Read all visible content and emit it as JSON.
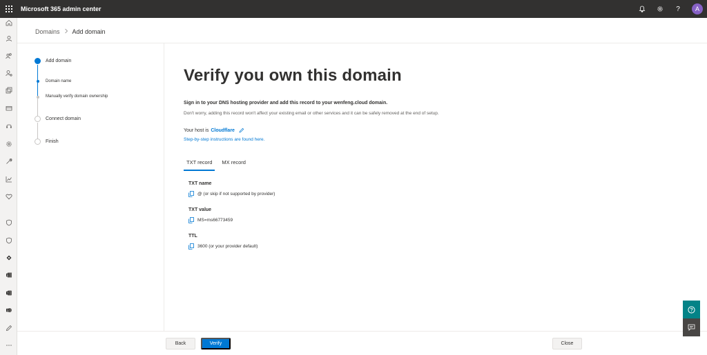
{
  "app": {
    "title": "Microsoft 365 admin center"
  },
  "topbar": {
    "avatar_initial": "A"
  },
  "breadcrumb": {
    "parent": "Domains",
    "current": "Add domain"
  },
  "stepper": {
    "steps": [
      {
        "label": "Add domain",
        "state": "current"
      },
      {
        "label": "Domain name",
        "state": "substep-done"
      },
      {
        "label": "Manually verify domain ownership",
        "state": "substep-current"
      },
      {
        "label": "Connect domain",
        "state": "pending"
      },
      {
        "label": "Finish",
        "state": "pending"
      }
    ]
  },
  "main": {
    "title": "Verify you own this domain",
    "instruction": "Sign in to your DNS hosting provider and add this record to your wenfeng.cloud domain.",
    "subtext": "Don't worry, adding this record won't affect your existing email or other services and it can be safely removed at the end of setup.",
    "host_prefix": "Your host is",
    "host_name": "Cloudflare",
    "instructions_link": "Step-by-step instructions are found here.",
    "tabs": [
      {
        "label": "TXT record",
        "active": true
      },
      {
        "label": "MX record",
        "active": false
      }
    ],
    "fields": [
      {
        "label": "TXT name",
        "value": "@ (or skip if not supported by provider)"
      },
      {
        "label": "TXT value",
        "value": "MS=ms66773459"
      },
      {
        "label": "TTL",
        "value": "3600 (or your provider default)"
      }
    ]
  },
  "footer": {
    "back_label": "Back",
    "verify_label": "Verify",
    "close_label": "Close"
  },
  "colors": {
    "accent": "#0078d4",
    "topbar": "#323130",
    "help": "#038387"
  },
  "rail_icons": [
    "home-icon",
    "user-icon",
    "users-icon",
    "admin-roles-icon",
    "resources-icon",
    "billing-icon",
    "support-icon",
    "settings-icon",
    "setup-icon",
    "reports-icon",
    "health-icon",
    "security-icon",
    "compliance-icon",
    "endpoint-manager-icon",
    "exchange-icon",
    "teams-icon",
    "sharepoint-icon",
    "customize-icon",
    "more-icon"
  ]
}
